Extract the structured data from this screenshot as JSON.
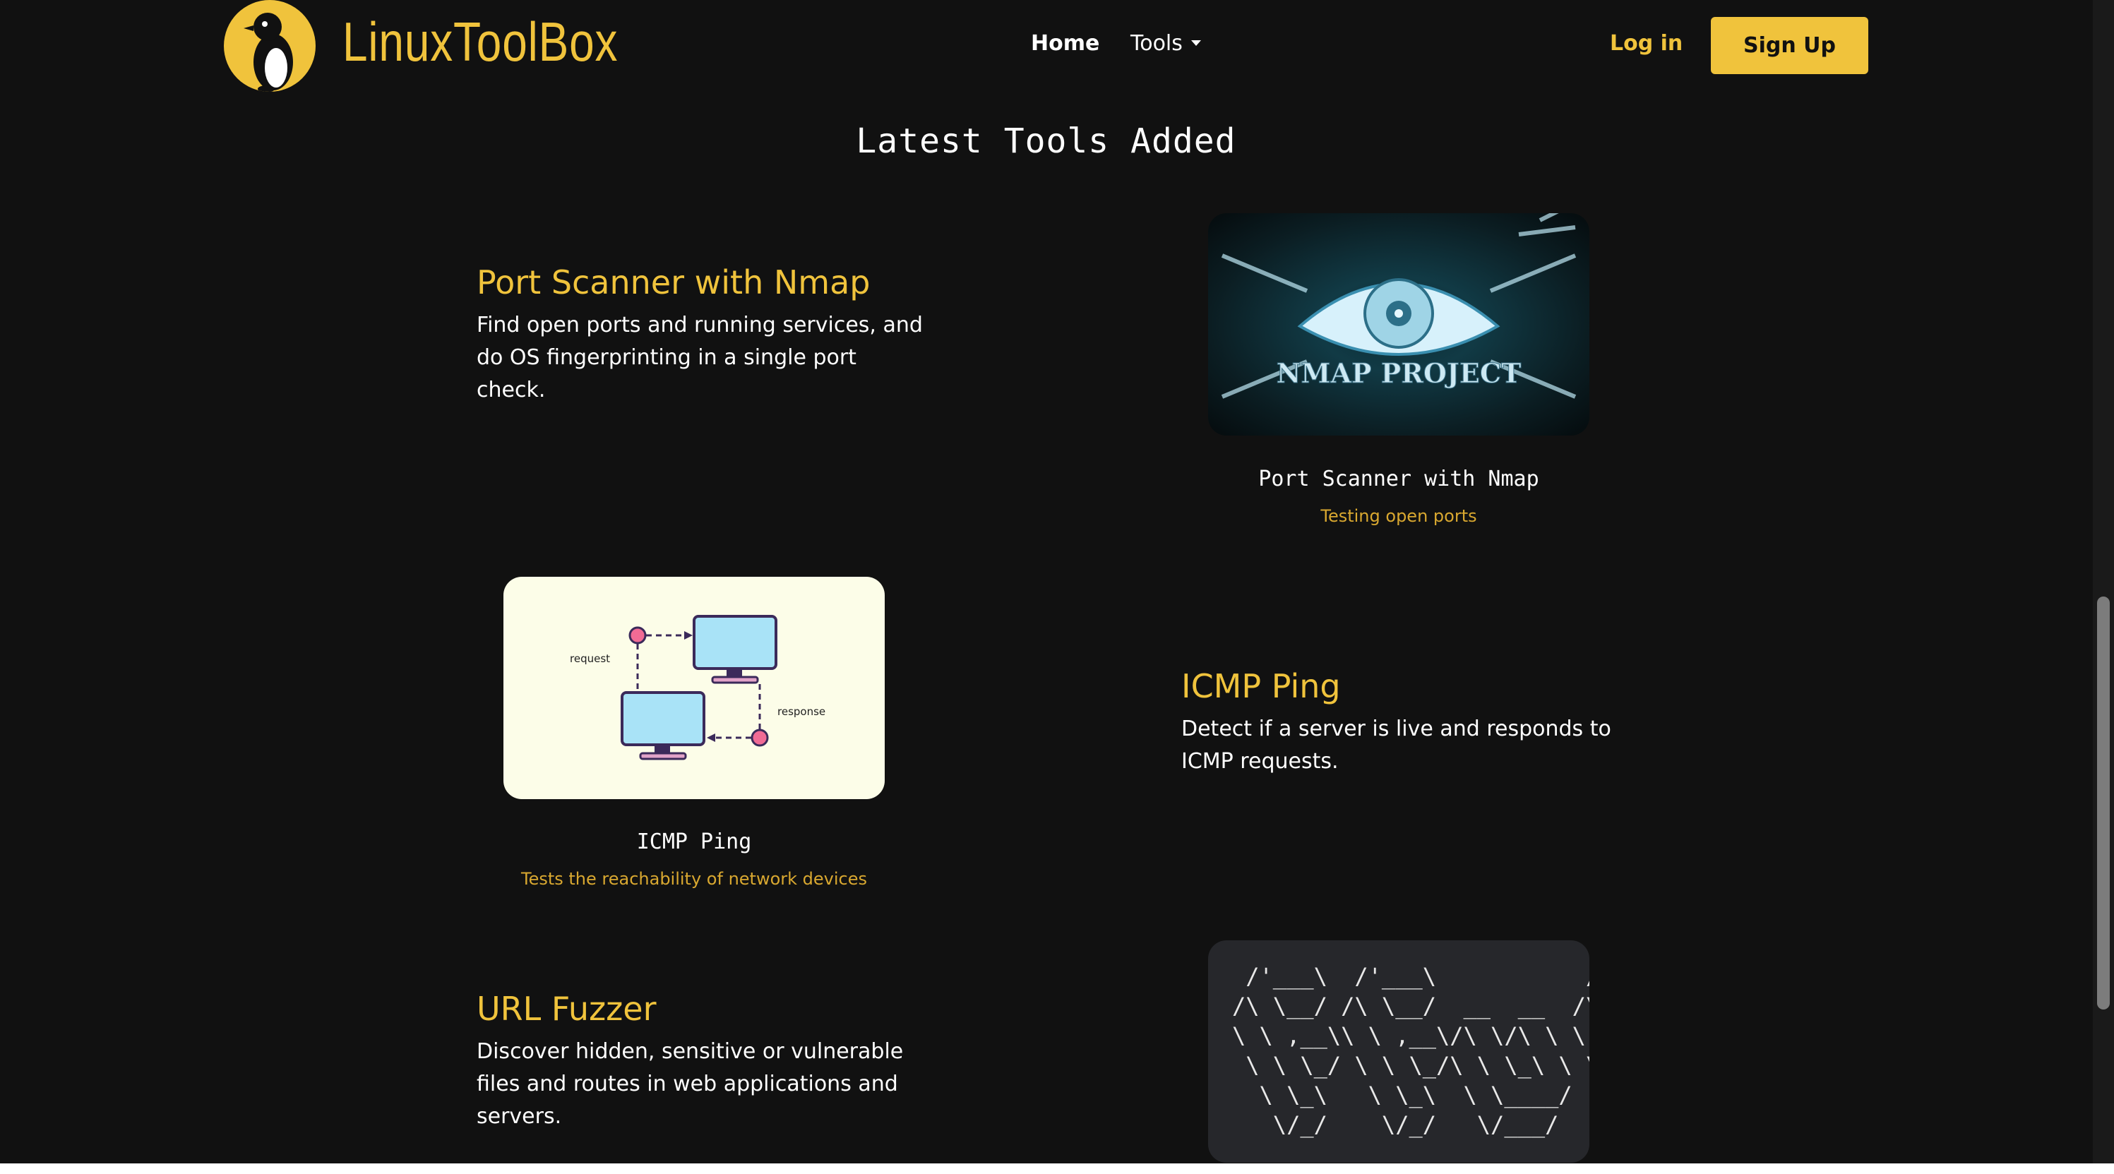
{
  "header": {
    "brand": "LinuxToolBox",
    "nav_home": "Home",
    "nav_tools": "Tools",
    "login": "Log in",
    "signup": "Sign Up",
    "logo_icon": "penguin-icon"
  },
  "section_title": "Latest Tools Added",
  "tools": [
    {
      "title": "Port Scanner with Nmap",
      "description": "Find open ports and running services, and do OS fingerprinting in a single port check.",
      "card_title": "Port Scanner with Nmap",
      "card_subtitle": "Testing open ports",
      "image_text": "NMAP PROJECT"
    },
    {
      "title": "ICMP Ping",
      "description": "Detect if a server is live and responds to ICMP requests.",
      "card_title": "ICMP Ping",
      "card_subtitle": "Tests the reachability of network devices",
      "image_labels": {
        "request": "request",
        "response": "response"
      }
    },
    {
      "title": "URL Fuzzer",
      "description": "Discover hidden, sensitive or vulnerable files and routes in web applications and servers.",
      "ascii_art": " /'___\\  /'___\\           /'___\\\n/\\ \\__/ /\\ \\__/  __  __  /\\ \\__/\n\\ \\ ,__\\\\ \\ ,__\\/\\ \\/\\ \\ \\ \\ ,__\\\n \\ \\ \\_/ \\ \\ \\_/\\ \\ \\_\\ \\ \\ \\ \\_/\n  \\ \\_\\   \\ \\_\\  \\ \\____/  \\ \\_\\\n   \\/_/    \\/_/   \\/___/    \\/_/"
    }
  ],
  "colors": {
    "accent": "#f0c33c",
    "background": "#111111",
    "subtitle": "#d9a830"
  }
}
